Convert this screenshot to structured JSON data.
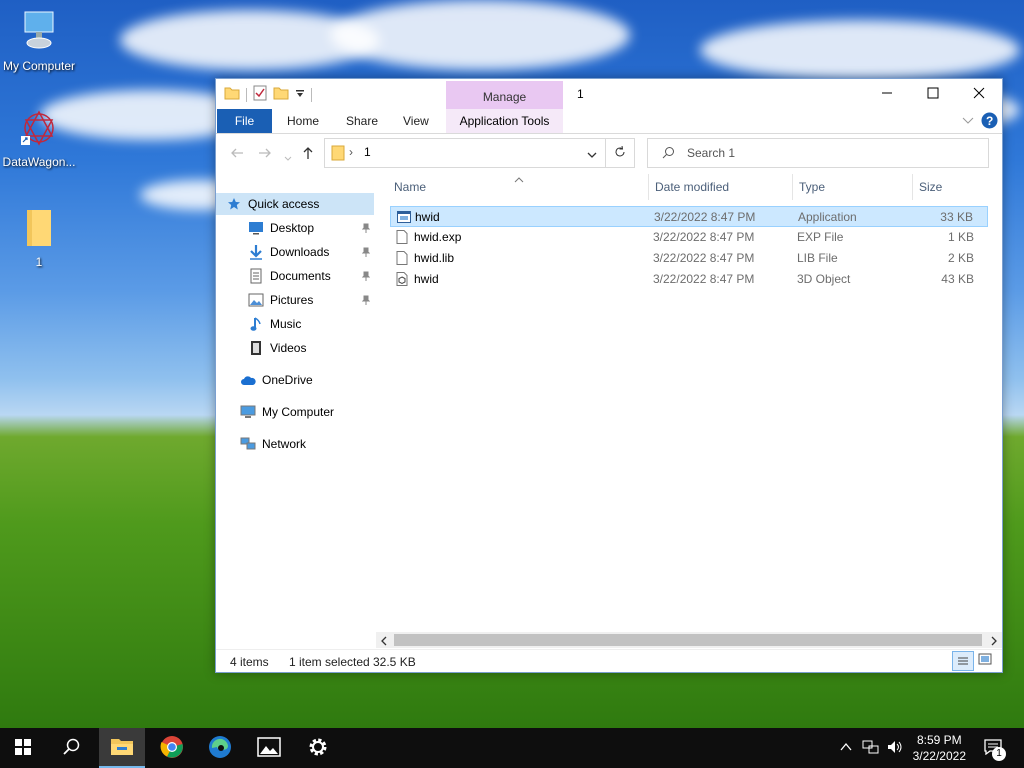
{
  "desktop": {
    "icons": [
      {
        "label": "My Computer"
      },
      {
        "label": "DataWagon..."
      },
      {
        "label": "1"
      }
    ]
  },
  "window": {
    "title": "1",
    "manage_tab": "Manage",
    "ribbon_tabs": [
      "File",
      "Home",
      "Share",
      "View"
    ],
    "app_tools_tab": "Application Tools",
    "address": {
      "path_separator": "›",
      "path": "1"
    },
    "search": {
      "placeholder": "Search 1"
    },
    "nav_pane": {
      "quick_access": "Quick access",
      "items": [
        {
          "label": "Desktop",
          "pinned": true
        },
        {
          "label": "Downloads",
          "pinned": true
        },
        {
          "label": "Documents",
          "pinned": true
        },
        {
          "label": "Pictures",
          "pinned": true
        },
        {
          "label": "Music",
          "pinned": false
        },
        {
          "label": "Videos",
          "pinned": false
        }
      ],
      "onedrive": "OneDrive",
      "my_computer": "My Computer",
      "network": "Network"
    },
    "columns": {
      "name": "Name",
      "date": "Date modified",
      "type": "Type",
      "size": "Size"
    },
    "files": [
      {
        "name": "hwid",
        "date": "3/22/2022 8:47 PM",
        "type": "Application",
        "size": "33 KB",
        "icon": "application-icon",
        "selected": true
      },
      {
        "name": "hwid.exp",
        "date": "3/22/2022 8:47 PM",
        "type": "EXP File",
        "size": "1 KB",
        "icon": "file-icon",
        "selected": false
      },
      {
        "name": "hwid.lib",
        "date": "3/22/2022 8:47 PM",
        "type": "LIB File",
        "size": "2 KB",
        "icon": "file-icon",
        "selected": false
      },
      {
        "name": "hwid",
        "date": "3/22/2022 8:47 PM",
        "type": "3D Object",
        "size": "43 KB",
        "icon": "3d-object-icon",
        "selected": false
      }
    ],
    "status": {
      "items": "4 items",
      "selected": "1 item selected",
      "size": "32.5 KB"
    }
  },
  "taskbar": {
    "clock_time": "8:59 PM",
    "clock_date": "3/22/2022",
    "notification_count": "1"
  },
  "colors": {
    "file_tab": "#1a5fb4",
    "manage_tab": "#e9c8f2",
    "selection": "#cce8ff",
    "nav_selection": "#cce4f7"
  }
}
